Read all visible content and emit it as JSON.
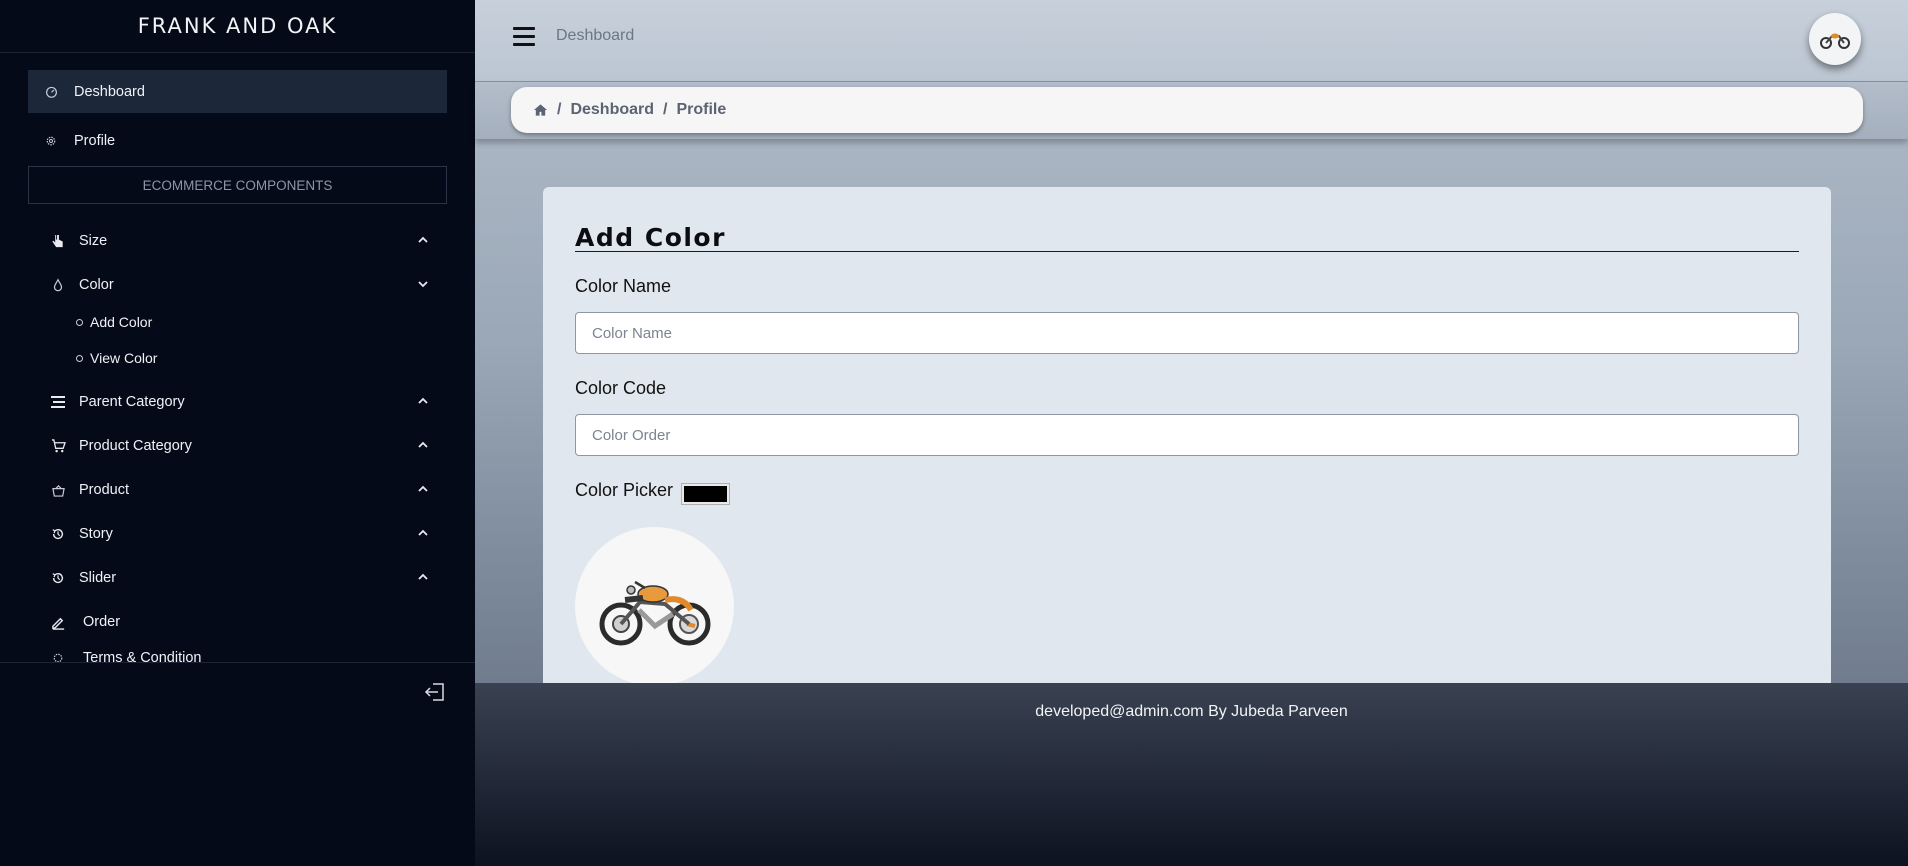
{
  "sidebar": {
    "brand": "FRANK AND OAK",
    "items": [
      {
        "label": "Deshboard"
      },
      {
        "label": "Profile"
      }
    ],
    "section_label": "ECOMMERCE COMPONENTS",
    "menus": [
      {
        "label": "Size"
      },
      {
        "label": "Color"
      },
      {
        "label": "Parent Category"
      },
      {
        "label": "Product Category"
      },
      {
        "label": "Product"
      },
      {
        "label": "Story"
      },
      {
        "label": "Slider"
      },
      {
        "label": "Order"
      },
      {
        "label": "Terms & Condition"
      }
    ],
    "color_submenu": [
      {
        "label": "Add Color"
      },
      {
        "label": "View Color"
      }
    ]
  },
  "header": {
    "title": "Deshboard"
  },
  "breadcrumb": {
    "items": [
      "Deshboard",
      "Profile"
    ]
  },
  "form": {
    "title": "Add Color",
    "color_name_label": "Color Name",
    "color_name_placeholder": "Color Name",
    "color_code_label": "Color Code",
    "color_code_placeholder": "Color Order",
    "color_picker_label": "Color Picker",
    "picker_value": "#000000"
  },
  "footer": {
    "text": "developed@admin.com By Jubeda Parveen"
  },
  "colors": {
    "sidebar_bg": "#050a18",
    "active_item_bg": "#1c2739",
    "card_bg": "#e1e7ef"
  }
}
